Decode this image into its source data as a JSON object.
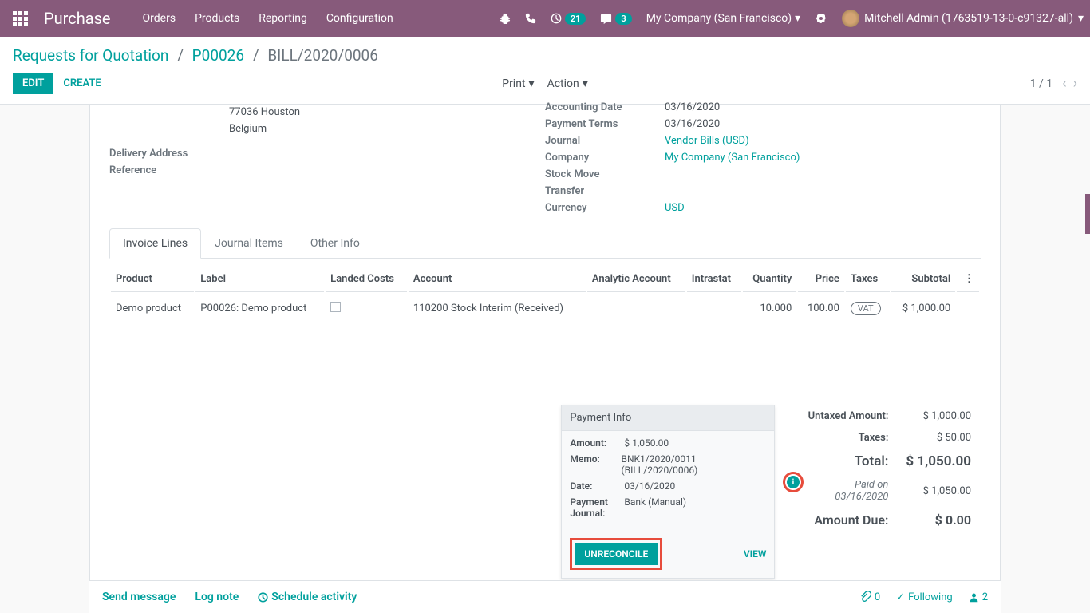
{
  "nav": {
    "app_title": "Purchase",
    "menu": [
      "Orders",
      "Products",
      "Reporting",
      "Configuration"
    ],
    "activities_badge": "21",
    "messages_badge": "3",
    "company": "My Company (San Francisco)",
    "user": "Mitchell Admin (1763519-13-0-c91327-all)"
  },
  "breadcrumb": {
    "root": "Requests for Quotation",
    "parent": "P00026",
    "current": "BILL/2020/0006"
  },
  "controls": {
    "edit": "EDIT",
    "create": "CREATE",
    "print": "Print",
    "action": "Action",
    "pager": "1 / 1"
  },
  "form": {
    "address_line1": "77036 Houston",
    "address_line2": "Belgium",
    "labels": {
      "delivery_address": "Delivery Address",
      "reference": "Reference",
      "accounting_date": "Accounting Date",
      "payment_terms": "Payment Terms",
      "journal": "Journal",
      "company": "Company",
      "stock_move": "Stock Move",
      "transfer": "Transfer",
      "currency": "Currency"
    },
    "values": {
      "accounting_date": "03/16/2020",
      "payment_terms": "03/16/2020",
      "journal": "Vendor Bills (USD)",
      "company": "My Company (San Francisco)",
      "currency": "USD"
    }
  },
  "tabs": [
    "Invoice Lines",
    "Journal Items",
    "Other Info"
  ],
  "table": {
    "headers": {
      "product": "Product",
      "label": "Label",
      "landed_costs": "Landed Costs",
      "account": "Account",
      "analytic": "Analytic Account",
      "intrastat": "Intrastat",
      "quantity": "Quantity",
      "price": "Price",
      "taxes": "Taxes",
      "subtotal": "Subtotal"
    },
    "row": {
      "product": "Demo product",
      "label": "P00026: Demo product",
      "account": "110200 Stock Interim (Received)",
      "quantity": "10.000",
      "price": "100.00",
      "tax": "VAT",
      "subtotal": "$ 1,000.00"
    }
  },
  "payment_info": {
    "title": "Payment Info",
    "labels": {
      "amount": "Amount:",
      "memo": "Memo:",
      "date": "Date:",
      "journal": "Payment Journal:"
    },
    "values": {
      "amount": "$ 1,050.00",
      "memo": "BNK1/2020/0011 (BILL/2020/0006)",
      "date": "03/16/2020",
      "journal": "Bank (Manual)"
    },
    "unreconcile": "UNRECONCILE",
    "view": "VIEW"
  },
  "totals": {
    "untaxed_label": "Untaxed Amount:",
    "untaxed_value": "$ 1,000.00",
    "taxes_label": "Taxes:",
    "taxes_value": "$ 50.00",
    "total_label": "Total:",
    "total_value": "$ 1,050.00",
    "paid_label": "Paid on 03/16/2020",
    "paid_value": "$ 1,050.00",
    "due_label": "Amount Due:",
    "due_value": "$ 0.00"
  },
  "chatter": {
    "send": "Send message",
    "log": "Log note",
    "schedule": "Schedule activity",
    "attach_count": "0",
    "following": "Following",
    "followers": "2"
  }
}
